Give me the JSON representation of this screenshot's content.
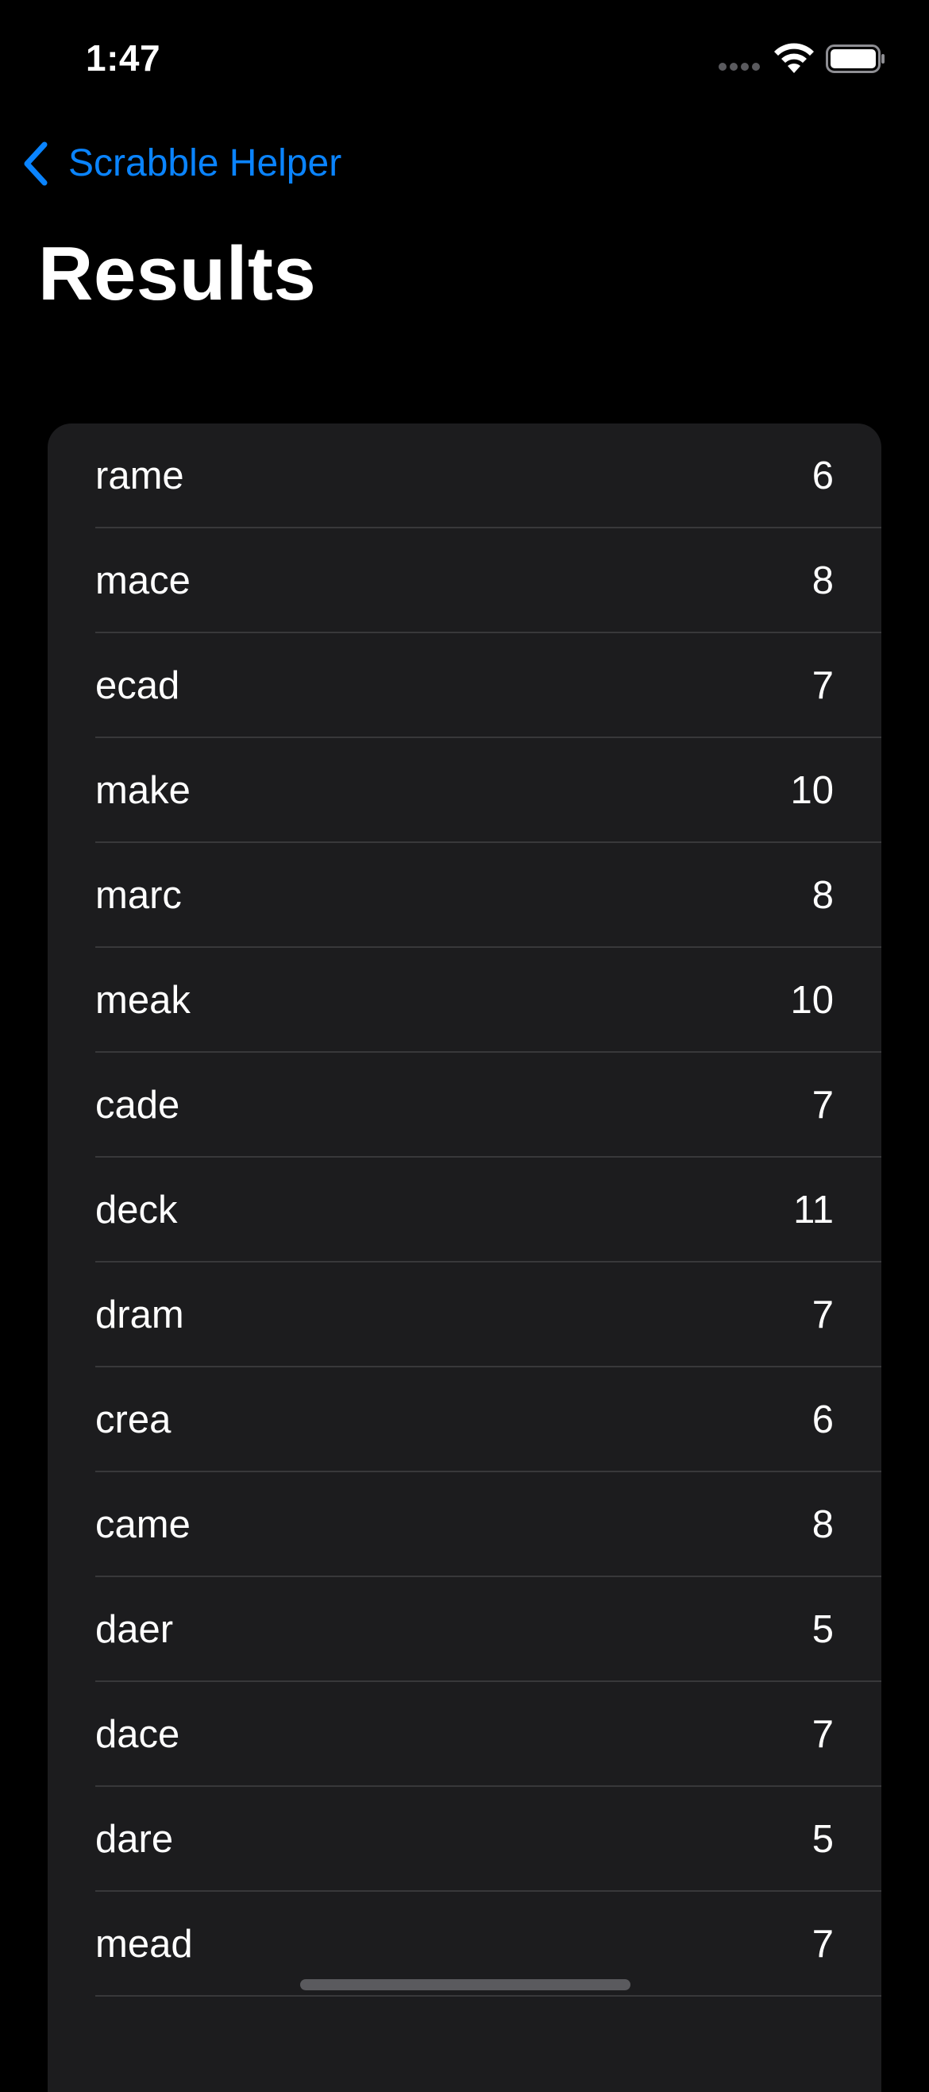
{
  "status_bar": {
    "time": "1:47"
  },
  "nav": {
    "back_label": "Scrabble Helper"
  },
  "page": {
    "title": "Results"
  },
  "results": [
    {
      "word": "rame",
      "score": "6"
    },
    {
      "word": "mace",
      "score": "8"
    },
    {
      "word": "ecad",
      "score": "7"
    },
    {
      "word": "make",
      "score": "10"
    },
    {
      "word": "marc",
      "score": "8"
    },
    {
      "word": "meak",
      "score": "10"
    },
    {
      "word": "cade",
      "score": "7"
    },
    {
      "word": "deck",
      "score": "11"
    },
    {
      "word": "dram",
      "score": "7"
    },
    {
      "word": "crea",
      "score": "6"
    },
    {
      "word": "came",
      "score": "8"
    },
    {
      "word": "daer",
      "score": "5"
    },
    {
      "word": "dace",
      "score": "7"
    },
    {
      "word": "dare",
      "score": "5"
    },
    {
      "word": "mead",
      "score": "7"
    }
  ],
  "colors": {
    "background": "#000000",
    "list_background": "#1c1c1e",
    "separator": "#38383a",
    "accent": "#0a84ff",
    "text": "#ffffff"
  },
  "icons": {
    "back": "chevron-left-icon",
    "wifi": "wifi-icon",
    "battery": "battery-icon",
    "signal": "signal-icon"
  }
}
